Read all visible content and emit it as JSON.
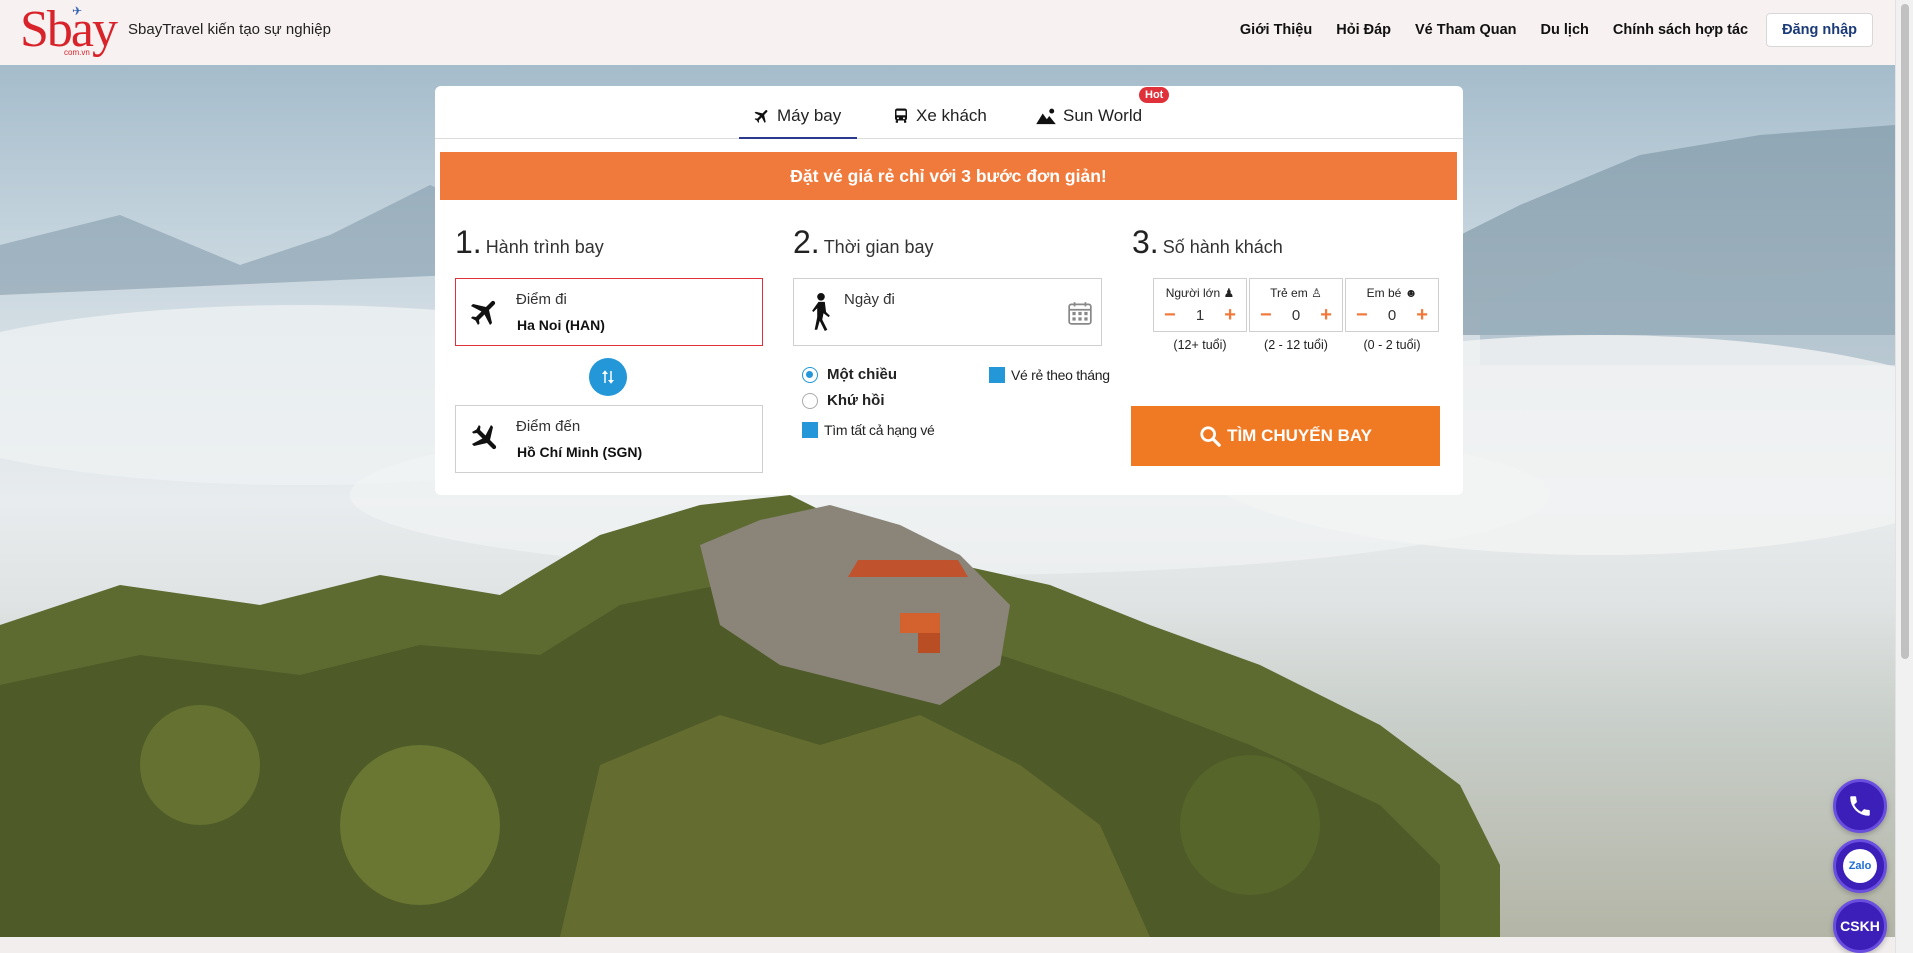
{
  "header": {
    "logo_text": "Sbay",
    "logo_sub": "com.vn",
    "tagline": "SbayTravel kiến tạo sự nghiệp",
    "nav": [
      "Giới Thiệu",
      "Hỏi Đáp",
      "Vé Tham Quan",
      "Du lịch",
      "Chính sách hợp tác"
    ],
    "login_label": "Đăng nhập"
  },
  "tabs": [
    {
      "label": "Máy bay",
      "icon": "airplane-icon",
      "active": true
    },
    {
      "label": "Xe khách",
      "icon": "bus-icon",
      "active": false
    },
    {
      "label": "Sun World",
      "icon": "mountain-icon",
      "active": false
    }
  ],
  "hot_badge": "Hot",
  "promo": "Đặt vé giá rẻ chỉ với 3 bước đơn giản!",
  "step1": {
    "num": "1.",
    "title": "Hành trình bay",
    "from_label": "Điểm đi",
    "from_value": "Ha Noi (HAN)",
    "to_label": "Điểm đến",
    "to_value": "Hồ Chí Minh (SGN)"
  },
  "step2": {
    "num": "2.",
    "title": "Thời gian bay",
    "date_placeholder": "Ngày đi",
    "one_way": "Một chiều",
    "round_trip": "Khứ hồi",
    "cheap_monthly": "Vé rẻ theo tháng",
    "all_classes": "Tìm tất cả hạng vé"
  },
  "step3": {
    "num": "3.",
    "title": "Số hành khách",
    "passengers": [
      {
        "label": "Người lớn",
        "count": "1",
        "age": "(12+ tuổi)"
      },
      {
        "label": "Trẻ em",
        "count": "0",
        "age": "(2 - 12 tuổi)"
      },
      {
        "label": "Em bé",
        "count": "0",
        "age": "(0 - 2 tuổi)"
      }
    ],
    "minus": "−",
    "plus": "+"
  },
  "search_label": "TÌM CHUYẾN BAY",
  "fab": {
    "zalo": "Zalo",
    "cskh": "CSKH"
  },
  "colors": {
    "brand_red": "#d8232a",
    "orange": "#f07a3c",
    "blue": "#2397d8",
    "nav_active": "#2b3a8f",
    "fab": "#3b1fb8"
  }
}
